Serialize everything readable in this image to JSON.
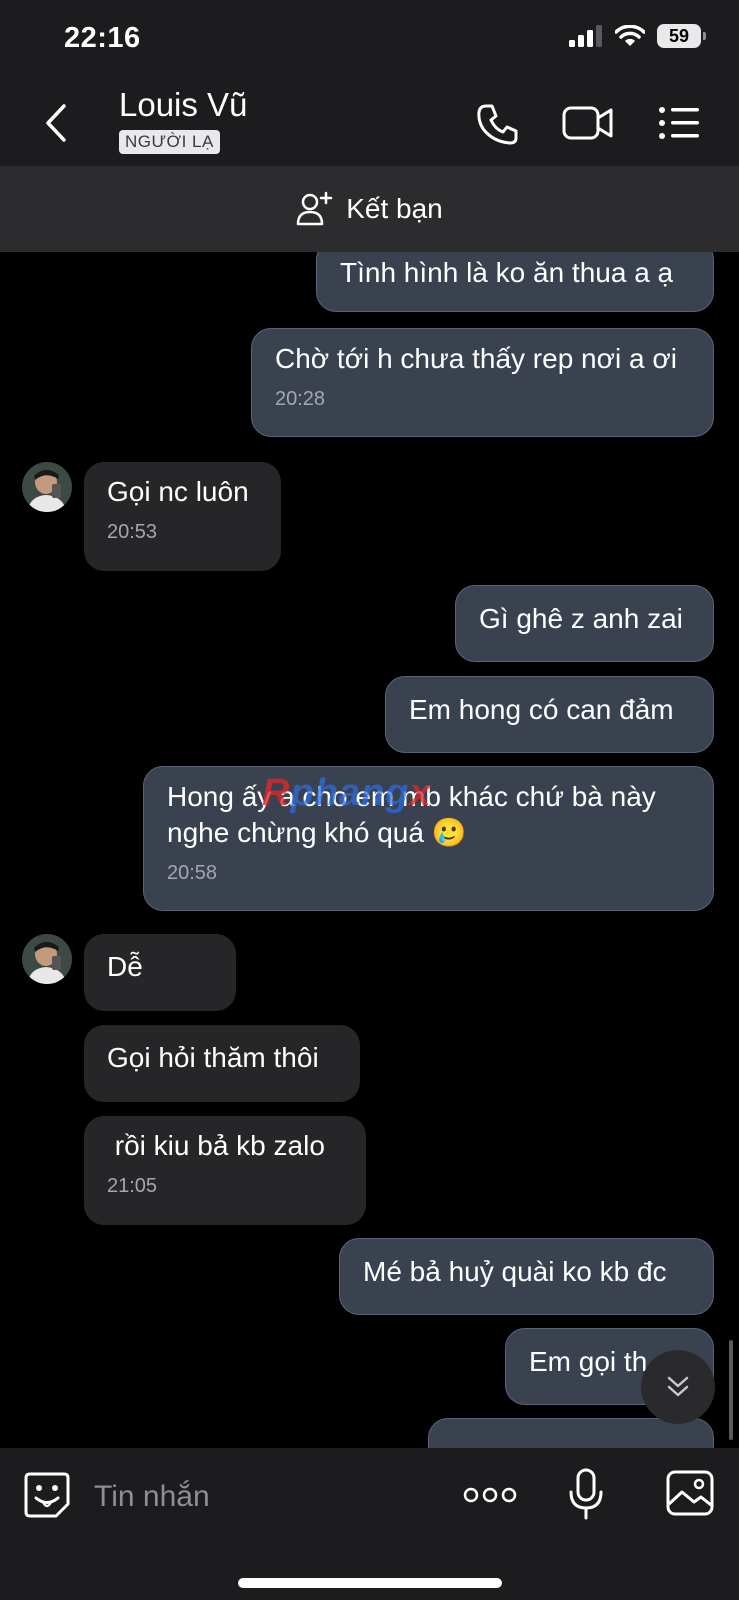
{
  "status_bar": {
    "time": "22:16",
    "battery": "59"
  },
  "header": {
    "contact_name": "Louis Vũ",
    "badge": "NGƯỜI LẠ"
  },
  "add_friend": {
    "label": "Kết bạn"
  },
  "messages": [
    {
      "direction": "out",
      "text": "Tình hình là ko ăn thua a ạ"
    },
    {
      "direction": "out",
      "text": "Chờ tới h chưa thấy rep nơi a ơi",
      "time": "20:28"
    },
    {
      "direction": "in",
      "text": "Gọi nc luôn",
      "time": "20:53"
    },
    {
      "direction": "out",
      "text": "Gì ghê z anh zai"
    },
    {
      "direction": "out",
      "text": "Em hong có can đảm"
    },
    {
      "direction": "out",
      "line1": "Hong ấy a cho em mb khác chứ bà này",
      "line2": "nghe chừng khó quá 🥲",
      "time": "20:58"
    },
    {
      "direction": "in",
      "text": "Dễ"
    },
    {
      "direction": "in",
      "text": "Gọi hỏi thăm thôi"
    },
    {
      "direction": "in",
      "text": " rồi kiu bả kb zalo",
      "time": "21:05"
    },
    {
      "direction": "out",
      "text": "Mé bả huỷ quài ko kb đc"
    },
    {
      "direction": "out",
      "text": "Em gọi th"
    }
  ],
  "watermark": {
    "r": "R",
    "mid": "phang",
    "x": "x"
  },
  "input": {
    "placeholder": "Tin nhắn"
  },
  "icons": {
    "signal": "cellular-signal-icon",
    "wifi": "wifi-icon",
    "battery": "battery-icon",
    "back": "chevron-left-icon",
    "call": "phone-icon",
    "video": "video-camera-icon",
    "menu": "list-icon",
    "add_friend": "add-user-icon",
    "sticker": "sticker-icon",
    "more": "more-dots-icon",
    "mic": "microphone-icon",
    "gallery": "image-icon",
    "scroll_down": "chevron-double-down-icon"
  },
  "colors": {
    "outgoing_bubble": "#3a4250",
    "incoming_bubble": "#262628",
    "background": "#000000"
  }
}
